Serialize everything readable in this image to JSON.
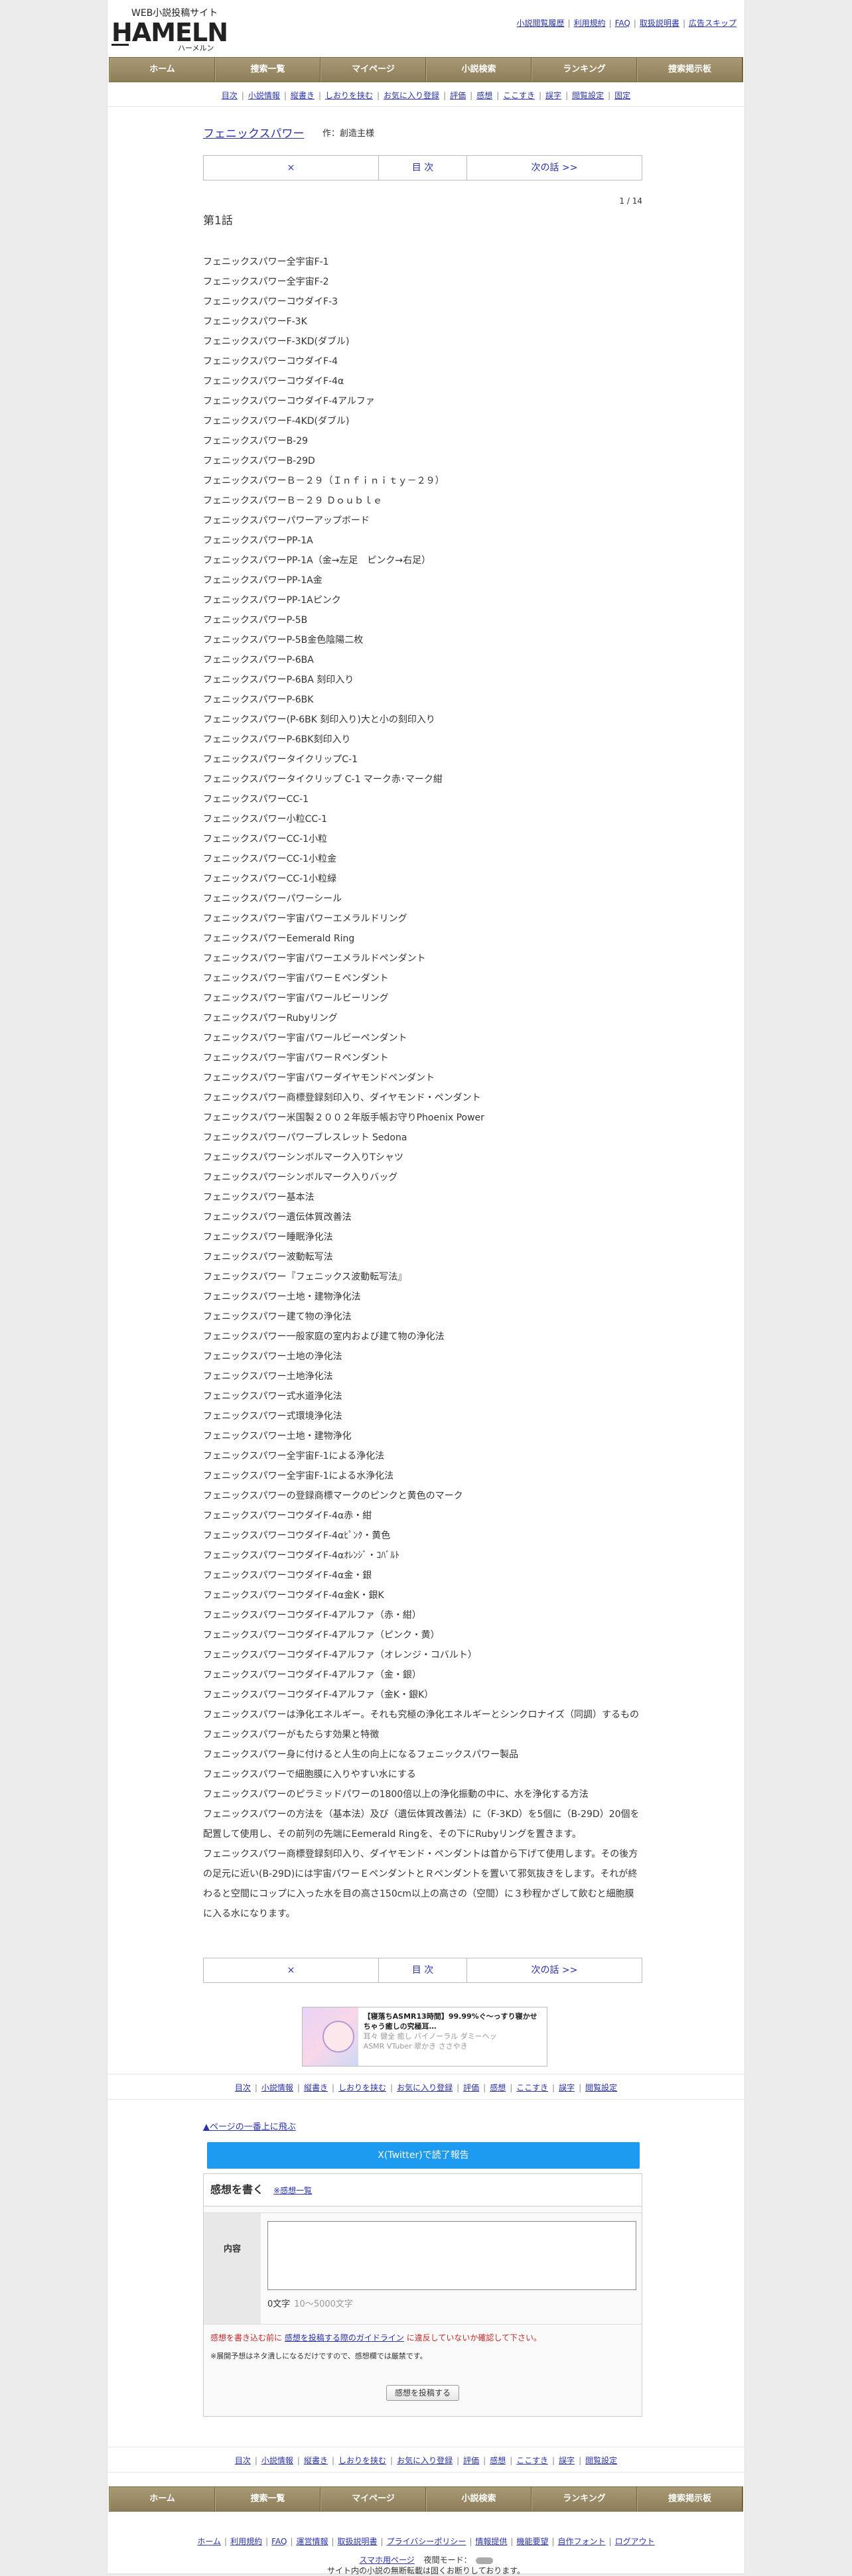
{
  "logo": {
    "tagline": "WEB小説投稿サイト",
    "name": "HAMELN",
    "kana": "ハーメルン"
  },
  "header_links": [
    "小説閲覧履歴",
    "利用規約",
    "FAQ",
    "取扱説明書",
    "広告スキップ"
  ],
  "navbar": [
    "ホーム",
    "捜索一覧",
    "マイページ",
    "小説検索",
    "ランキング",
    "捜索掲示板"
  ],
  "subnav": [
    "目次",
    "小説情報",
    "縦書き",
    "しおりを挟む",
    "お気に入り登録",
    "評価",
    "感想",
    "ここすき",
    "誤字",
    "閲覧設定",
    "固定"
  ],
  "subnav_bottom": [
    "目次",
    "小説情報",
    "縦書き",
    "しおりを挟む",
    "お気に入り登録",
    "評価",
    "感想",
    "ここすき",
    "誤字",
    "閲覧設定"
  ],
  "work": {
    "title": "フェニックスパワー",
    "author": "作：創造主様"
  },
  "pager": {
    "prev": "×",
    "toc": "目 次",
    "next": "次の話 >>"
  },
  "page_number": "1 / 14",
  "chapter_title": "第1話",
  "body_lines": [
    "フェニックスパワー全宇宙F-1",
    "フェニックスパワー全宇宙F-2",
    "フェニックスパワーコウダイF-3",
    "フェニックスパワーF-3K",
    "フェニックスパワーF-3KD(ダブル)",
    "フェニックスパワーコウダイF-4",
    "フェニックスパワーコウダイF-4α",
    "フェニックスパワーコウダイF-4アルファ",
    "フェニックスパワーF-4KD(ダブル)",
    "フェニックスパワーB-29",
    "フェニックスパワーB-29D",
    "フェニックスパワーＢ－２９（Ｉｎｆｉｎｉｔｙ－２９）",
    "フェニックスパワーＢ－２９ Ｄｏｕｂｌｅ",
    "フェニックスパワーパワーアップボード",
    "フェニックスパワーPP-1A",
    "フェニックスパワーPP-1A（金→左足　ピンク→右足）",
    "フェニックスパワーPP-1A金",
    "フェニックスパワーPP-1Aピンク",
    "フェニックスパワーP-5B",
    "フェニックスパワーP-5B金色陰陽二枚",
    "フェニックスパワーP-6BA",
    "フェニックスパワーP-6BA 刻印入り",
    "フェニックスパワーP-6BK",
    "フェニックスパワー(P-6BK 刻印入り)大と小の刻印入り",
    "フェニックスパワーP-6BK刻印入り",
    "フェニックスパワータイクリップC-1",
    "フェニックスパワータイクリップ C-1 マーク赤･マーク紺",
    "フェニックスパワーCC-1",
    "フェニックスパワー小粒CC-1",
    "フェニックスパワーCC-1小粒",
    "フェニックスパワーCC-1小粒金",
    "フェニックスパワーCC-1小粒緑",
    "フェニックスパワーパワーシール",
    "フェニックスパワー宇宙パワーエメラルドリング",
    "フェニックスパワーEemerald Ring",
    "フェニックスパワー宇宙パワーエメラルドペンダント",
    "フェニックスパワー宇宙パワーＥペンダント",
    "フェニックスパワー宇宙パワールビーリング",
    "フェニックスパワーRubyリング",
    "フェニックスパワー宇宙パワールビーペンダント",
    "フェニックスパワー宇宙パワーＲペンダント",
    "フェニックスパワー宇宙パワーダイヤモンドペンダント",
    "フェニックスパワー商標登録刻印入り、ダイヤモンド・ペンダント",
    "フェニックスパワー米国製２００２年版手帳お守りPhoenix Power",
    "フェニックスパワーパワーブレスレット Sedona",
    "フェニックスパワーシンボルマーク入りTシャツ",
    "フェニックスパワーシンボルマーク入りバッグ",
    "フェニックスパワー基本法",
    "フェニックスパワー遺伝体質改善法",
    "フェニックスパワー睡眠浄化法",
    "フェニックスパワー波動転写法",
    "フェニックスパワー『フェニックス波動転写法』",
    "フェニックスパワー土地・建物浄化法",
    "フェニックスパワー建て物の浄化法",
    "フェニックスパワー一般家庭の室内および建て物の浄化法",
    "フェニックスパワー土地の浄化法",
    "フェニックスパワー土地浄化法",
    "フェニックスパワー式水道浄化法",
    "フェニックスパワー式環境浄化法",
    "フェニックスパワー土地・建物浄化",
    "フェニックスパワー全宇宙F-1による浄化法",
    "フェニックスパワー全宇宙F-1による水浄化法",
    "フェニックスパワーの登録商標マークのピンクと黄色のマーク",
    "フェニックスパワーコウダイF-4α赤・紺",
    "フェニックスパワーコウダイF-4αﾋﾟﾝｸ・黄色",
    "フェニックスパワーコウダイF-4αｵﾚﾝｼﾞ・ｺﾊﾞﾙﾄ",
    "フェニックスパワーコウダイF-4α金・銀",
    "フェニックスパワーコウダイF-4α金K・銀K",
    "フェニックスパワーコウダイF-4アルファ（赤・紺）",
    "フェニックスパワーコウダイF-4アルファ（ピンク・黄）",
    "フェニックスパワーコウダイF-4アルファ（オレンジ・コバルト）",
    "フェニックスパワーコウダイF-4アルファ（金・銀）",
    "フェニックスパワーコウダイF-4アルファ（金K・銀K）",
    "フェニックスパワーは浄化エネルギー。それも究極の浄化エネルギーとシンクロナイズ（同調）するもの",
    "フェニックスパワーがもたらす効果と特徴",
    "フェニックスパワー身に付けると人生の向上になるフェニックスパワー製品",
    "フェニックスパワーで細胞膜に入りやすい水にする",
    "フェニックスパワーのピラミッドパワーの1800倍以上の浄化振動の中に、水を浄化する方法",
    "フェニックスパワーの方法を（基本法）及び（遺伝体質改善法）に（F-3KD）を5個に（B-29D）20個を配置して使用し、その前列の先端にEemerald Ringを、その下にRubyリングを置きます。",
    "フェニックスパワー商標登録刻印入り、ダイヤモンド・ペンダントは首から下げて使用します。その後方の足元に近い(B-29D)には宇宙パワーＥペンダントとＲペンダントを置いて邪気抜きをします。それが終わると空間にコップに入った水を目の高さ150cm以上の高さの（空間）に３秒程かざして飲むと細胞膜に入る水になります。"
  ],
  "banner": {
    "line1": "【寝落ちASMR13時間】99.99%ぐ〜っすり寝かせちゃう癒しの究極耳…",
    "line2": "耳々 健全 癒し バイノーラル ダミーヘッ",
    "line3": "ASMR VTuber 翠かき ささやき"
  },
  "back_to_top": "▲ページの一番上に飛ぶ",
  "twitter_button": "X(Twitter)で読了報告",
  "impression": {
    "heading": "感想を書く",
    "list_link": "※感想一覧",
    "field_label": "内容",
    "count": "0文字",
    "count_hint": "10〜5000文字",
    "note_prefix": "感想を書き込む前に",
    "note_link": "感想を投稿する際のガイドライン",
    "note_suffix": "に違反していないか確認して下さい。",
    "note2": "※展開予想はネタ潰しになるだけですので、感想欄では厳禁です。",
    "submit": "感想を投稿する"
  },
  "footer_links": [
    "ホーム",
    "利用規約",
    "FAQ",
    "運営情報",
    "取扱説明書",
    "プライバシーポリシー",
    "情報提供",
    "機能要望",
    "自作フォント",
    "ログアウト"
  ],
  "footer_sp": {
    "link": "スマホ用ページ",
    "mode_label": "夜間モード："
  },
  "footer_copy": "サイト内の小説の無断転載は固くお断りしております。"
}
